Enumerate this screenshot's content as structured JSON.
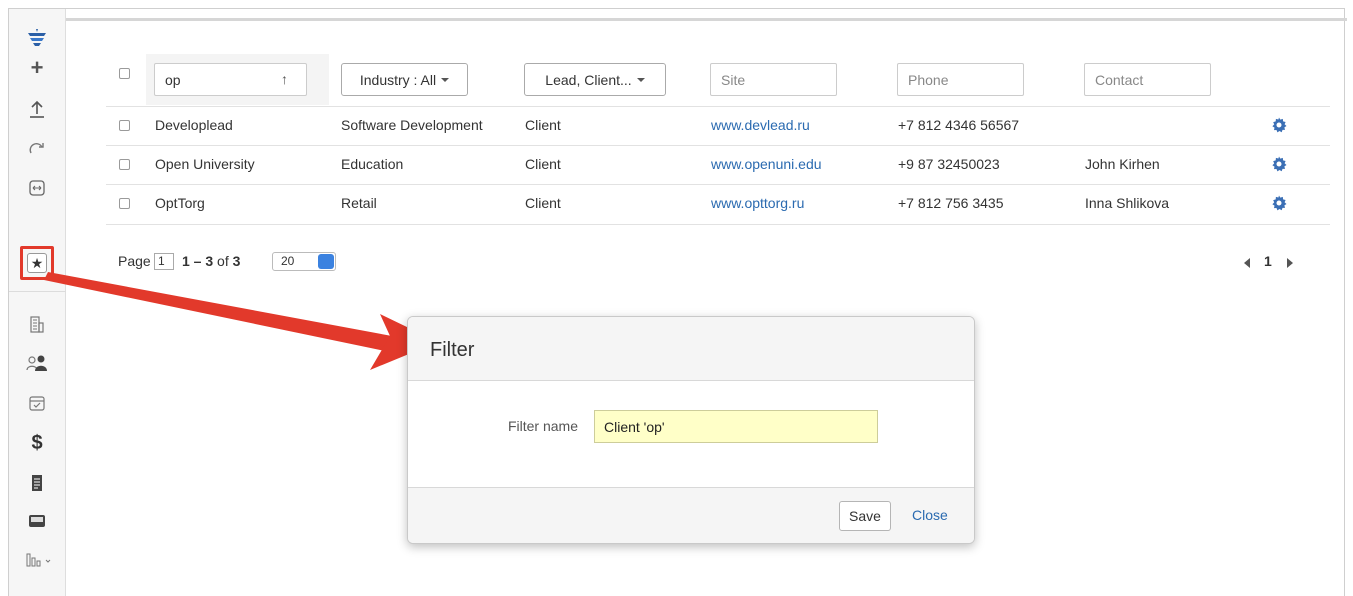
{
  "sidebar": {
    "icons": [
      "logo-icon",
      "plus-icon",
      "upload-icon",
      "refresh-icon",
      "merge-icon",
      "star-icon",
      "building-icon",
      "contacts-icon",
      "calendar-icon",
      "dollar-icon",
      "document-icon",
      "inbox-icon",
      "chart-icon"
    ]
  },
  "filters": {
    "name_value": "op",
    "industry_label": "Industry : All",
    "type_label": "Lead, Client...",
    "site_placeholder": "Site",
    "phone_placeholder": "Phone",
    "contact_placeholder": "Contact"
  },
  "rows": [
    {
      "name": "Developlead",
      "industry": "Software Development",
      "type": "Client",
      "site": "www.devlead.ru",
      "phone": "+7 812 4346 56567",
      "contact": ""
    },
    {
      "name": "Open University",
      "industry": "Education",
      "type": "Client",
      "site": "www.openuni.edu",
      "phone": "+9 87 32450023",
      "contact": "John Kirhen"
    },
    {
      "name": "OptTorg",
      "industry": "Retail",
      "type": "Client",
      "site": "www.opttorg.ru",
      "phone": "+7 812 756 3435",
      "contact": "Inna Shlikova"
    }
  ],
  "pager": {
    "label": "Page",
    "page": "1",
    "range_bold": "1 – 3",
    "range_of": " of ",
    "total": "3",
    "per_page": "20",
    "current_page": "1"
  },
  "modal": {
    "title": "Filter",
    "field_label": "Filter name",
    "field_value": "Client 'op'",
    "save_label": "Save",
    "close_label": "Close"
  },
  "colors": {
    "accent": "#2a6ab0",
    "highlight": "#e2392b",
    "input_highlight": "#ffffc8"
  }
}
